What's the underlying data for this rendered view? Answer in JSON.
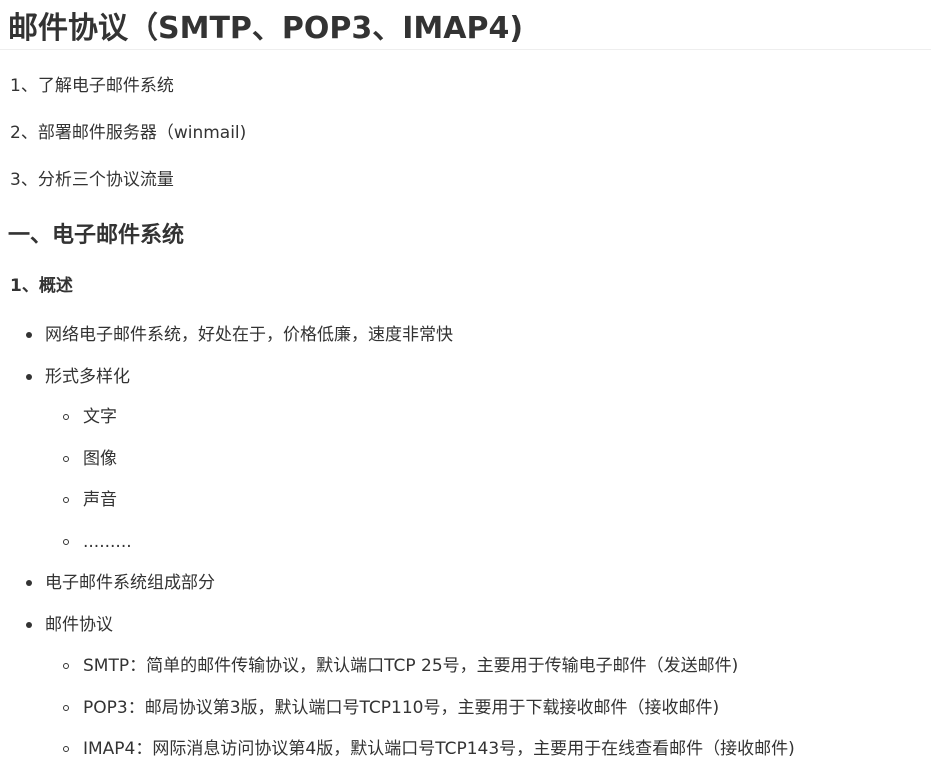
{
  "title": "邮件协议（SMTP、POP3、IMAP4)",
  "intro": [
    "1、了解电子邮件系统",
    "2、部署邮件服务器（winmail)",
    "3、分析三个协议流量"
  ],
  "section1": {
    "heading": "一、电子邮件系统",
    "subheading": "1、概述",
    "items": {
      "advantage": "网络电子邮件系统，好处在于，价格低廉，速度非常快",
      "forms": {
        "label": "形式多样化",
        "children": [
          "文字",
          "图像",
          "声音",
          "........."
        ]
      },
      "components": "电子邮件系统组成部分",
      "protocols": {
        "label": "邮件协议",
        "children": [
          "SMTP：简单的邮件传输协议，默认端口TCP 25号，主要用于传输电子邮件（发送邮件)",
          "POP3：邮局协议第3版，默认端口号TCP110号，主要用于下载接收邮件（接收邮件)",
          "IMAP4：网际消息访问协议第4版，默认端口号TCP143号，主要用于在线查看邮件（接收邮件)"
        ]
      }
    }
  }
}
